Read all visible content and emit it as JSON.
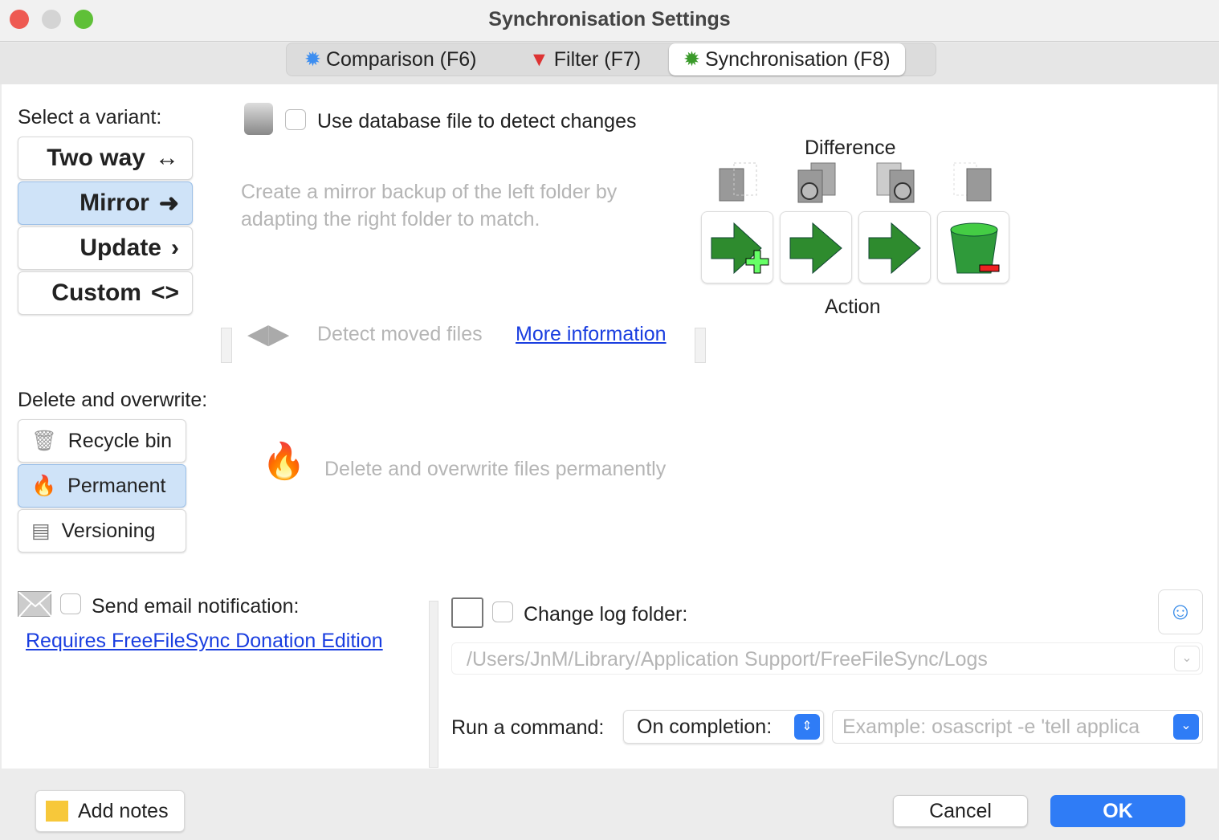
{
  "window": {
    "title": "Synchronisation Settings"
  },
  "tabs": [
    {
      "label": "Comparison (F6)",
      "icon": "gear-blue-icon"
    },
    {
      "label": "Filter (F7)",
      "icon": "funnel-red-icon"
    },
    {
      "label": "Synchronisation (F8)",
      "icon": "gear-green-icon",
      "active": true
    }
  ],
  "variant": {
    "label": "Select a variant:",
    "options": [
      {
        "label": "Two way",
        "glyph": "↔"
      },
      {
        "label": "Mirror",
        "glyph": "➜",
        "selected": true
      },
      {
        "label": "Update",
        "glyph": "›"
      },
      {
        "label": "Custom",
        "glyph": "<>"
      }
    ]
  },
  "database": {
    "label": "Use database file to detect changes",
    "checked": false
  },
  "description": "Create a mirror backup of the left folder by adapting the right folder to match.",
  "detect_moved": {
    "label": "Detect moved files",
    "link": "More information"
  },
  "matrix": {
    "difference_label": "Difference",
    "action_label": "Action"
  },
  "delete": {
    "label": "Delete and overwrite:",
    "options": [
      {
        "label": "Recycle bin"
      },
      {
        "label": "Permanent",
        "selected": true
      },
      {
        "label": "Versioning"
      }
    ],
    "description": "Delete and overwrite files permanently"
  },
  "email": {
    "label": "Send email notification:",
    "checked": false,
    "link": "Requires FreeFileSync Donation Edition"
  },
  "log": {
    "label": "Change log folder:",
    "checked": false,
    "path": "/Users/JnM/Library/Application Support/FreeFileSync/Logs"
  },
  "command": {
    "label": "Run a command:",
    "select": "On completion:",
    "placeholder": "Example: osascript -e 'tell applica"
  },
  "footer": {
    "add_notes": "Add notes",
    "cancel": "Cancel",
    "ok": "OK"
  },
  "colors": {
    "accent": "#2f7cf6",
    "selected": "#cfe3f8",
    "link": "#1a3ee0"
  }
}
